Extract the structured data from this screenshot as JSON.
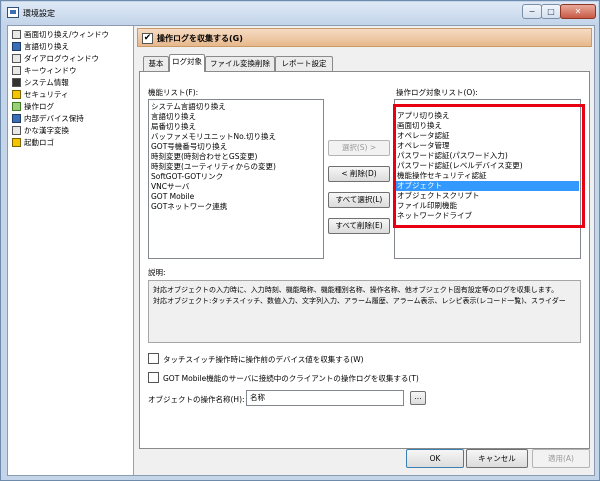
{
  "window": {
    "title": "環境設定",
    "minimize": "−",
    "maximize": "□",
    "close": "✕"
  },
  "tree": {
    "items": [
      {
        "label": "画面切り換え/ウィンドウ",
        "icon": "screen-switch-icon"
      },
      {
        "label": "言語切り換え",
        "icon": "language-icon"
      },
      {
        "label": "ダイアログウィンドウ",
        "icon": "dialog-window-icon"
      },
      {
        "label": "キーウィンドウ",
        "icon": "key-window-icon"
      },
      {
        "label": "システム情報",
        "icon": "system-info-icon"
      },
      {
        "label": "セキュリティ",
        "icon": "security-icon"
      },
      {
        "label": "操作ログ",
        "icon": "operation-log-icon"
      },
      {
        "label": "内部デバイス保持",
        "icon": "internal-device-icon"
      },
      {
        "label": "かな漢字変換",
        "icon": "kana-kanji-icon"
      },
      {
        "label": "起動ロゴ",
        "icon": "startup-logo-icon"
      }
    ]
  },
  "header": {
    "checked": "✔",
    "label": "操作ログを収集する(G)"
  },
  "tabs": [
    "基本",
    "ログ対象",
    "ファイル変換削除",
    "レポート設定"
  ],
  "function_list": {
    "label": "機能リスト(F):",
    "items": [
      "システム言語切り換え",
      "言語切り換え",
      "局番切り換え",
      "バッファメモリユニットNo.切り換え",
      "GOT号機番号切り換え",
      "時刻変更(時刻合わせとGS変更)",
      "時刻変更(ユーティリティからの変更)",
      "SoftGOT-GOTリンク",
      "VNCサーバ",
      "GOT Mobile",
      "GOTネットワーク連携"
    ]
  },
  "buttons": {
    "select": "選択(S) >",
    "delete": "< 削除(D)",
    "select_all": "すべて選択(L)",
    "delete_all": "すべて削除(E)"
  },
  "target_list": {
    "label": "操作ログ対象リスト(O):",
    "highlight_color": "#e60012",
    "selected_index": 8,
    "items": [
      "アプリ切り換え",
      "画面切り換え",
      "オペレータ認証",
      "オペレータ管理",
      "パスワード認証(パスワード入力)",
      "パスワード認証(レベルデバイス変更)",
      "機能操作セキュリティ認証",
      "オブジェクト",
      "オブジェクトスクリプト",
      "ファイル印刷機能",
      "ネットワークドライブ"
    ]
  },
  "description": {
    "label": "説明:",
    "line1": "対応オブジェクトの入力時に、入力時刻、機能略称、機能種別名称、操作名称、他オブジェクト固有設定等のログを収集します。",
    "line2": "対応オブジェクト:タッチスイッチ、数値入力、文字列入力、アラーム履歴、アラーム表示、レシピ表示(レコード一覧)、スライダー"
  },
  "options": {
    "collect_device_value": "タッチスイッチ操作時に操作前のデバイス値を収集する(W)",
    "collect_gotmobile": "GOT Mobile機能のサーバに接続中のクライアントの操作ログを収集する(T)"
  },
  "object_name": {
    "label": "オブジェクトの操作名称(H):",
    "value": "名称",
    "browse": "..."
  },
  "footer": {
    "ok": "OK",
    "cancel": "キャンセル",
    "apply": "適用(A)"
  }
}
